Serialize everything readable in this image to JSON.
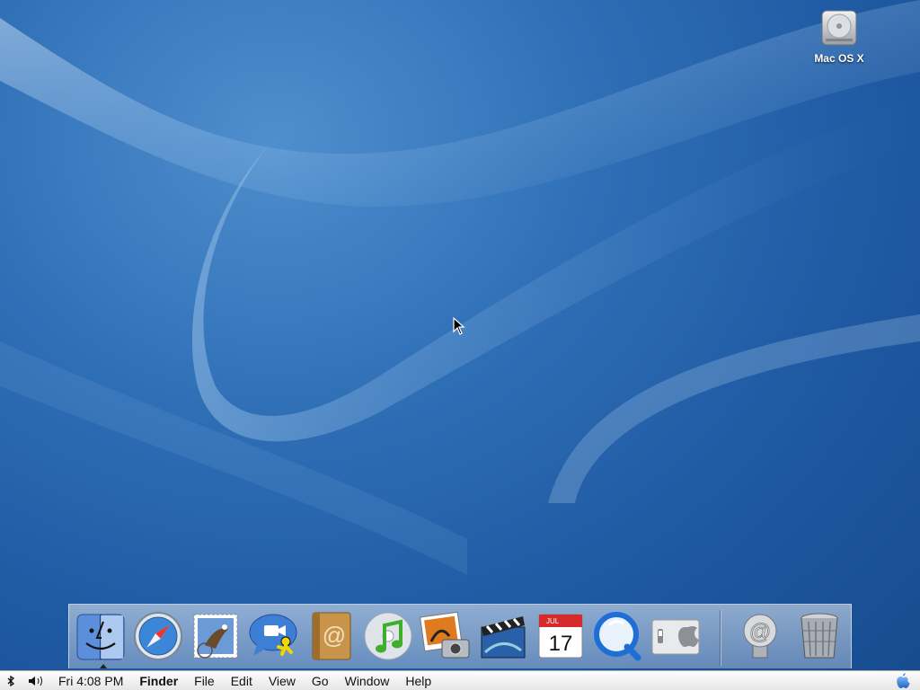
{
  "desktop": {
    "icons": [
      {
        "label": "Mac OS X",
        "icon": "hard-drive-icon"
      }
    ]
  },
  "dock": {
    "items": [
      {
        "name": "Finder",
        "icon": "finder-icon",
        "running": true
      },
      {
        "name": "Safari",
        "icon": "safari-icon"
      },
      {
        "name": "Mail",
        "icon": "mail-icon"
      },
      {
        "name": "iChat",
        "icon": "ichat-icon"
      },
      {
        "name": "Address Book",
        "icon": "address-book-icon"
      },
      {
        "name": "iTunes",
        "icon": "itunes-icon"
      },
      {
        "name": "iPhoto",
        "icon": "iphoto-icon"
      },
      {
        "name": "iMovie",
        "icon": "imovie-icon"
      },
      {
        "name": "iCal",
        "icon": "ical-icon",
        "month": "JUL",
        "day": "17"
      },
      {
        "name": "QuickTime Player",
        "icon": "quicktime-icon"
      },
      {
        "name": "System Preferences",
        "icon": "system-preferences-icon"
      }
    ],
    "right_items": [
      {
        "name": "Internet Connect",
        "icon": "at-sign-icon"
      },
      {
        "name": "Trash",
        "icon": "trash-icon"
      }
    ]
  },
  "menubar": {
    "extras": [
      "bluetooth-icon",
      "volume-icon"
    ],
    "clock": "Fri 4:08 PM",
    "app_name": "Finder",
    "menus": [
      "File",
      "Edit",
      "View",
      "Go",
      "Window",
      "Help"
    ],
    "apple_icon": "apple-icon"
  }
}
